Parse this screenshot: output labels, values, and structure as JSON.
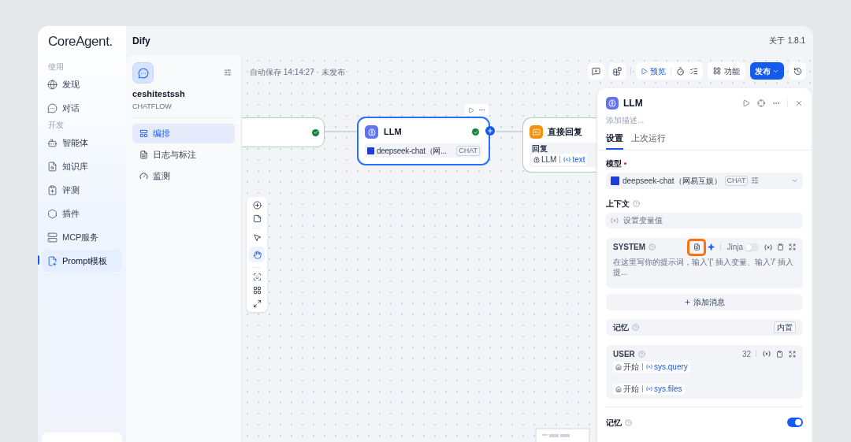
{
  "brand": {
    "logo": "CoreAgent."
  },
  "sidebar": {
    "sections": [
      {
        "label": "使用",
        "items": [
          {
            "label": "发现",
            "selected": false
          },
          {
            "label": "对话",
            "selected": false
          }
        ]
      },
      {
        "label": "开发",
        "items": [
          {
            "label": "智能体",
            "selected": false
          },
          {
            "label": "知识库",
            "selected": false
          },
          {
            "label": "评测",
            "selected": false
          },
          {
            "label": "插件",
            "selected": false
          },
          {
            "label": "MCP服务",
            "selected": false
          },
          {
            "label": "Prompt模板",
            "selected": true
          }
        ]
      }
    ]
  },
  "topbar": {
    "product": "Dify",
    "about": "关于",
    "version": "1.8.1"
  },
  "app": {
    "name": "ceshitestssh",
    "type": "CHATFLOW",
    "nav": [
      {
        "label": "编排",
        "selected": true
      },
      {
        "label": "日志与标注",
        "selected": false
      },
      {
        "label": "监测",
        "selected": false
      }
    ]
  },
  "canvas": {
    "autosave": "自动保存 14:14:27 · 未发布",
    "llm_node": {
      "title": "LLM",
      "model": "deepseek-chat（网...",
      "badge": "CHAT",
      "selected": true
    },
    "answer_node": {
      "title": "直接回复",
      "label": "回复",
      "source": "LLM",
      "variable": "text"
    },
    "toolbar": {
      "preview": "预览",
      "features": "功能",
      "publish": "发布"
    }
  },
  "panel": {
    "title": "LLM",
    "description_placeholder": "添加描述...",
    "tabs": [
      {
        "label": "设置",
        "selected": true
      },
      {
        "label": "上次运行",
        "selected": false
      }
    ],
    "model": {
      "label": "模型",
      "required": true,
      "value": "deepseek-chat（网易互娱）",
      "badge": "CHAT"
    },
    "context": {
      "label": "上下文",
      "placeholder": "设置变量值"
    },
    "system": {
      "role": "SYSTEM",
      "jinja_label": "Jinja",
      "jinja_on": false,
      "placeholder": "在这里写你的提示词，输入'{' 插入变量、输入'/' 插入提..."
    },
    "add_message": "添加消息",
    "memory_row": {
      "label": "记忆",
      "badge": "内置"
    },
    "user": {
      "role": "USER",
      "count": "32",
      "variables": [
        {
          "node": "开始",
          "variable": "sys.query"
        },
        {
          "node": "开始",
          "variable": "sys.files"
        }
      ]
    },
    "memory": {
      "label": "记忆",
      "on": true
    }
  }
}
